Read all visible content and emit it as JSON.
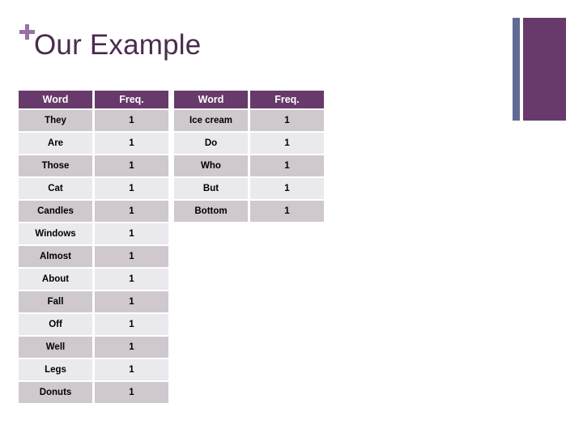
{
  "slide": {
    "title": "Our Example",
    "plus_icon": "plus-icon",
    "accent_purple": "#673a6b",
    "accent_blue": "#606a96",
    "title_color": "#4a2b4f",
    "row_odd_color": "#cfc8cf",
    "row_even_color": "#eaeaee"
  },
  "tables": [
    {
      "id": "left",
      "columns": [
        "Word",
        "Freq."
      ],
      "rows": [
        [
          "They",
          "1"
        ],
        [
          "Are",
          "1"
        ],
        [
          "Those",
          "1"
        ],
        [
          "Cat",
          "1"
        ],
        [
          "Candles",
          "1"
        ],
        [
          "Windows",
          "1"
        ],
        [
          "Almost",
          "1"
        ],
        [
          "About",
          "1"
        ],
        [
          "Fall",
          "1"
        ],
        [
          "Off",
          "1"
        ],
        [
          "Well",
          "1"
        ],
        [
          "Legs",
          "1"
        ],
        [
          "Donuts",
          "1"
        ]
      ]
    },
    {
      "id": "right",
      "columns": [
        "Word",
        "Freq."
      ],
      "rows": [
        [
          "Ice cream",
          "1"
        ],
        [
          "Do",
          "1"
        ],
        [
          "Who",
          "1"
        ],
        [
          "But",
          "1"
        ],
        [
          "Bottom",
          "1"
        ]
      ]
    }
  ]
}
